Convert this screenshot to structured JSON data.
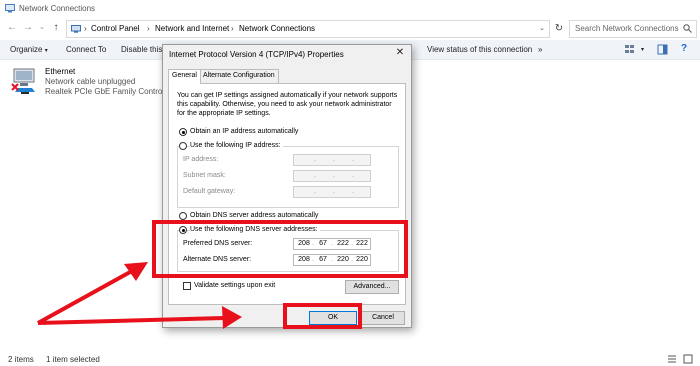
{
  "window": {
    "title": "Network Connections",
    "breadcrumbs": [
      "Control Panel",
      "Network and Internet",
      "Network Connections"
    ],
    "search_placeholder": "Search Network Connections"
  },
  "toolbar": {
    "organize": "Organize",
    "connect_to": "Connect To",
    "disable": "Disable this",
    "view_status": "View status of this connection",
    "more": "»"
  },
  "connection": {
    "name": "Ethernet",
    "status": "Network cable unplugged",
    "adapter": "Realtek PCIe GbE Family Controller"
  },
  "statusbar": {
    "items": "2 items",
    "selected": "1 item selected"
  },
  "dialog": {
    "title": "Internet Protocol Version 4 (TCP/IPv4) Properties",
    "close": "✕",
    "tabs": [
      "General",
      "Alternate Configuration"
    ],
    "description": "You can get IP settings assigned automatically if your network supports this capability. Otherwise, you need to ask your network administrator for the appropriate IP settings.",
    "ip_auto": "Obtain an IP address automatically",
    "ip_manual": "Use the following IP address:",
    "ip_fields": [
      "IP address:",
      "Subnet mask:",
      "Default gateway:"
    ],
    "dns_auto": "Obtain DNS server address automatically",
    "dns_manual": "Use the following DNS server addresses:",
    "preferred_label": "Preferred DNS server:",
    "alternate_label": "Alternate DNS server:",
    "preferred_dns": [
      "208",
      "67",
      "222",
      "222"
    ],
    "alternate_dns": [
      "208",
      "67",
      "220",
      "220"
    ],
    "validate": "Validate settings upon exit",
    "advanced": "Advanced...",
    "ok": "OK",
    "cancel": "Cancel",
    "selected_ip_option": "auto",
    "selected_dns_option": "manual",
    "validate_checked": false
  },
  "colors": {
    "highlight": "#e8111b",
    "toolbar_bg": "#f0f4f9",
    "dialog_bg": "#f0f0f0",
    "default_button_border": "#0078d7"
  }
}
